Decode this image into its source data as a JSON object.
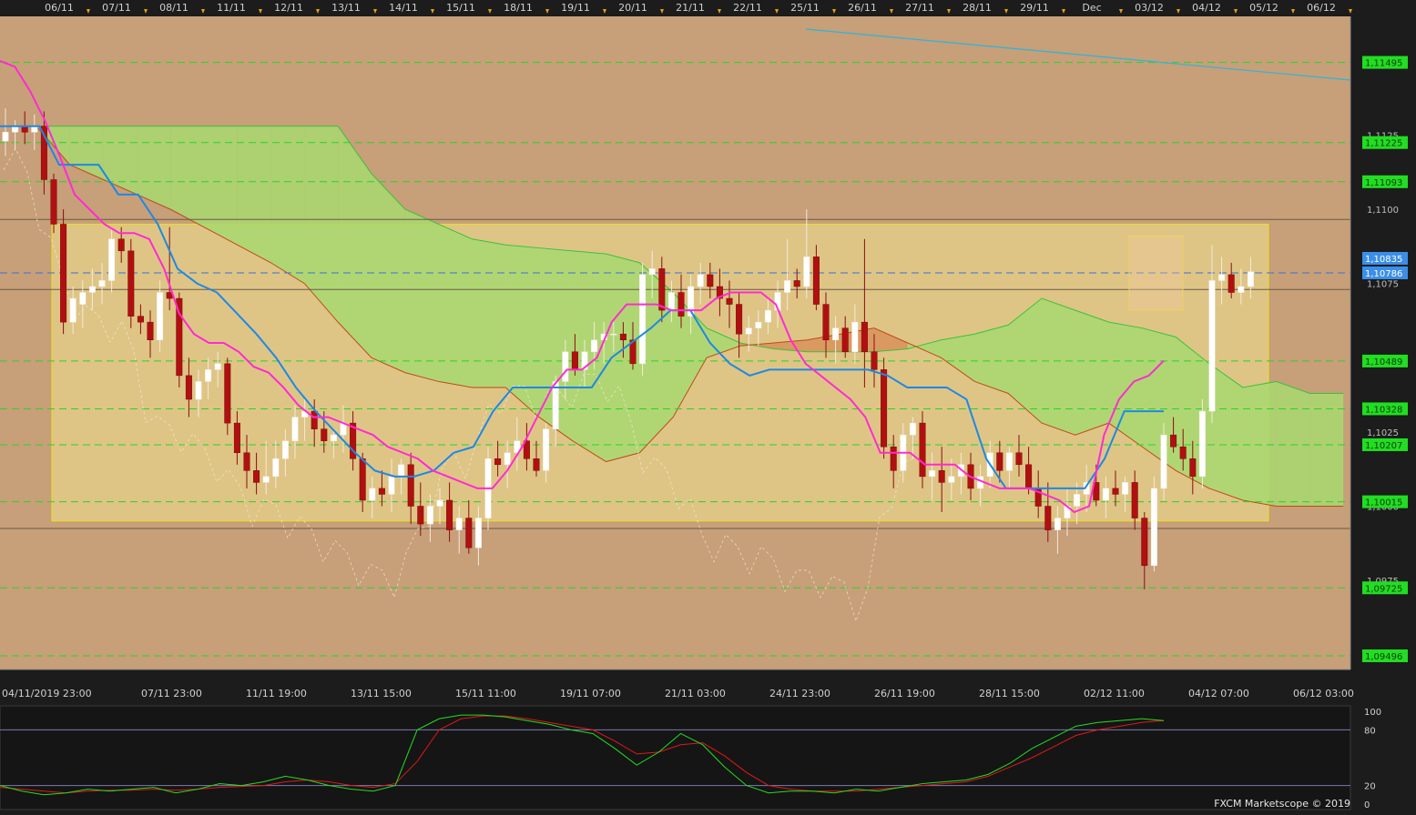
{
  "colors": {
    "background": "#1c1c1c",
    "plot_bg": "#c79f79",
    "highlight_box": "#e6d28a",
    "highlight_border": "#e8e020",
    "bull_candle": "#ffffff",
    "bear_candle": "#b01010",
    "tenkan": "#ff2bd2",
    "kijun": "#1e88e5",
    "chikou": "#f2ead8",
    "kumo_bull": "#a8d870",
    "kumo_bear": "#d9915a",
    "level_line": "#28d428",
    "price_marker_green": "#22dd22",
    "current_price_marker": "#3b8fe8",
    "trend_line": "#2ab6d8",
    "stoch_k": "#22dd22",
    "stoch_d": "#e01818"
  },
  "chart_data": {
    "type": "line",
    "title": "",
    "instrument_timeframe": "",
    "top_date_labels": [
      "06/11",
      "07/11",
      "08/11",
      "11/11",
      "12/11",
      "13/11",
      "14/11",
      "15/11",
      "18/11",
      "19/11",
      "20/11",
      "21/11",
      "22/11",
      "25/11",
      "26/11",
      "27/11",
      "28/11",
      "29/11",
      "Dec",
      "03/12",
      "04/12",
      "05/12",
      "06/12"
    ],
    "bottom_date_labels": [
      "04/11/2019 23:00",
      "07/11 23:00",
      "11/11 19:00",
      "13/11 15:00",
      "15/11 11:00",
      "19/11 07:00",
      "21/11 03:00",
      "24/11 23:00",
      "26/11 19:00",
      "28/11 15:00",
      "02/12 11:00",
      "04/12 07:00",
      "06/12 03:00"
    ],
    "y_axis": {
      "ylim": [
        1.0945,
        1.1165
      ],
      "tick_labels": [
        "1,1125",
        "1,1100",
        "1,1075",
        "1,1025",
        "1,1000",
        "1,0975"
      ],
      "tick_values": [
        1.1125,
        1.11,
        1.1075,
        1.1025,
        1.1,
        1.0975
      ]
    },
    "horizontal_levels": [
      {
        "label": "1,11495",
        "value": 1.11495,
        "style": "dashed"
      },
      {
        "label": "1,11225",
        "value": 1.11225,
        "style": "dashed"
      },
      {
        "label": "1,11093",
        "value": 1.11093,
        "style": "dashed"
      },
      {
        "label": "1,10489",
        "value": 1.10489,
        "style": "dashed"
      },
      {
        "label": "1,10328",
        "value": 1.10328,
        "style": "dashed"
      },
      {
        "label": "1,10207",
        "value": 1.10207,
        "style": "dashed"
      },
      {
        "label": "1,10015",
        "value": 1.10015,
        "style": "dashed"
      },
      {
        "label": "1,09725",
        "value": 1.09725,
        "style": "dashed"
      },
      {
        "label": "1,09496",
        "value": 1.09496,
        "style": "dashed"
      },
      {
        "label": "1,10835",
        "value": 1.10835,
        "style": "marker"
      }
    ],
    "current_price": {
      "label": "1,10786",
      "value": 1.10786
    },
    "highlight_range": {
      "from_index": 4,
      "to_index": 171,
      "high": 1.1095,
      "low": 0.0
    },
    "highlight_range_prices": {
      "high": 1.1095,
      "low": 1.0995
    },
    "range_lines": [
      1.10966,
      1.1073,
      1.09925
    ],
    "candles": [
      [
        1.1123,
        1.1134,
        1.1118,
        1.1126
      ],
      [
        1.1126,
        1.113,
        1.112,
        1.1128
      ],
      [
        1.1128,
        1.1133,
        1.1122,
        1.1126
      ],
      [
        1.1126,
        1.1132,
        1.112,
        1.1128
      ],
      [
        1.1128,
        1.1133,
        1.1105,
        1.111
      ],
      [
        1.111,
        1.1112,
        1.1092,
        1.1095
      ],
      [
        1.1095,
        1.11,
        1.1058,
        1.1062
      ],
      [
        1.1062,
        1.1074,
        1.1058,
        1.107
      ],
      [
        1.1068,
        1.1076,
        1.106,
        1.1072
      ],
      [
        1.1072,
        1.108,
        1.1066,
        1.1074
      ],
      [
        1.1074,
        1.1082,
        1.1068,
        1.1076
      ],
      [
        1.1076,
        1.1094,
        1.1072,
        1.109
      ],
      [
        1.109,
        1.1094,
        1.1082,
        1.1086
      ],
      [
        1.1086,
        1.109,
        1.106,
        1.1064
      ],
      [
        1.1064,
        1.1068,
        1.1058,
        1.1062
      ],
      [
        1.1062,
        1.1066,
        1.105,
        1.1056
      ],
      [
        1.1056,
        1.1076,
        1.1052,
        1.1072
      ],
      [
        1.1072,
        1.1094,
        1.1066,
        1.107
      ],
      [
        1.107,
        1.1072,
        1.104,
        1.1044
      ],
      [
        1.1044,
        1.105,
        1.103,
        1.1036
      ],
      [
        1.1036,
        1.1046,
        1.103,
        1.1042
      ],
      [
        1.1042,
        1.105,
        1.1036,
        1.1046
      ],
      [
        1.1046,
        1.1052,
        1.104,
        1.1048
      ],
      [
        1.1048,
        1.105,
        1.1024,
        1.1028
      ],
      [
        1.1028,
        1.1032,
        1.1014,
        1.1018
      ],
      [
        1.1018,
        1.1024,
        1.1006,
        1.1012
      ],
      [
        1.1012,
        1.1018,
        1.1004,
        1.1008
      ],
      [
        1.1008,
        1.1022,
        1.1004,
        1.101
      ],
      [
        1.101,
        1.1022,
        1.1006,
        1.1016
      ],
      [
        1.1016,
        1.1026,
        1.101,
        1.1022
      ],
      [
        1.1022,
        1.1034,
        1.1016,
        1.103
      ],
      [
        1.103,
        1.1036,
        1.1022,
        1.1032
      ],
      [
        1.1032,
        1.1036,
        1.102,
        1.1026
      ],
      [
        1.1026,
        1.1032,
        1.1018,
        1.1022
      ],
      [
        1.1022,
        1.1026,
        1.1016,
        1.1024
      ],
      [
        1.1024,
        1.1034,
        1.1018,
        1.1028
      ],
      [
        1.1028,
        1.1032,
        1.1012,
        1.1016
      ],
      [
        1.1016,
        1.1018,
        1.0998,
        1.1002
      ],
      [
        1.1002,
        1.101,
        1.0996,
        1.1006
      ],
      [
        1.1006,
        1.1012,
        1.1,
        1.1004
      ],
      [
        1.1004,
        1.1016,
        1.0998,
        1.101
      ],
      [
        1.101,
        1.1016,
        1.1004,
        1.1014
      ],
      [
        1.1014,
        1.1018,
        1.0994,
        1.1
      ],
      [
        1.1,
        1.1008,
        1.099,
        1.0994
      ],
      [
        1.0994,
        1.1004,
        1.0988,
        1.1
      ],
      [
        1.1,
        1.1006,
        1.0994,
        1.1002
      ],
      [
        1.1002,
        1.1008,
        1.0988,
        1.0992
      ],
      [
        1.0992,
        1.1,
        1.0984,
        1.0996
      ],
      [
        1.0996,
        1.1002,
        1.0984,
        1.0986
      ],
      [
        1.0986,
        1.1,
        1.098,
        1.0996
      ],
      [
        1.0996,
        1.102,
        1.0992,
        1.1016
      ],
      [
        1.1016,
        1.1022,
        1.101,
        1.1014
      ],
      [
        1.1014,
        1.1022,
        1.1006,
        1.1018
      ],
      [
        1.1018,
        1.103,
        1.1012,
        1.1022
      ],
      [
        1.1022,
        1.1028,
        1.1012,
        1.1016
      ],
      [
        1.1016,
        1.1022,
        1.101,
        1.1012
      ],
      [
        1.1012,
        1.1028,
        1.1008,
        1.1026
      ],
      [
        1.1026,
        1.1044,
        1.102,
        1.1042
      ],
      [
        1.1042,
        1.1056,
        1.1036,
        1.1052
      ],
      [
        1.1052,
        1.1058,
        1.1044,
        1.1046
      ],
      [
        1.1046,
        1.1056,
        1.104,
        1.1052
      ],
      [
        1.1052,
        1.1062,
        1.1046,
        1.1056
      ],
      [
        1.1056,
        1.1062,
        1.1048,
        1.1058
      ],
      [
        1.1058,
        1.1062,
        1.1052,
        1.1058
      ],
      [
        1.1058,
        1.1062,
        1.105,
        1.1056
      ],
      [
        1.1056,
        1.1062,
        1.1046,
        1.1048
      ],
      [
        1.1048,
        1.1082,
        1.1044,
        1.1078
      ],
      [
        1.1078,
        1.1086,
        1.107,
        1.108
      ],
      [
        1.108,
        1.1084,
        1.1062,
        1.1066
      ],
      [
        1.1066,
        1.1076,
        1.1062,
        1.1072
      ],
      [
        1.1072,
        1.1078,
        1.106,
        1.1064
      ],
      [
        1.1064,
        1.1078,
        1.1058,
        1.1074
      ],
      [
        1.1074,
        1.1082,
        1.1068,
        1.1078
      ],
      [
        1.1078,
        1.1082,
        1.107,
        1.1074
      ],
      [
        1.1074,
        1.108,
        1.1064,
        1.107
      ],
      [
        1.107,
        1.1076,
        1.106,
        1.1068
      ],
      [
        1.1068,
        1.1072,
        1.105,
        1.1058
      ],
      [
        1.1058,
        1.1064,
        1.1052,
        1.106
      ],
      [
        1.106,
        1.1066,
        1.1054,
        1.1062
      ],
      [
        1.1062,
        1.107,
        1.1058,
        1.1066
      ],
      [
        1.1066,
        1.1076,
        1.106,
        1.1072
      ],
      [
        1.1072,
        1.109,
        1.1066,
        1.1076
      ],
      [
        1.1076,
        1.108,
        1.107,
        1.1074
      ],
      [
        1.1074,
        1.11,
        1.107,
        1.1084
      ],
      [
        1.1084,
        1.1088,
        1.1066,
        1.1068
      ],
      [
        1.1068,
        1.1072,
        1.105,
        1.1056
      ],
      [
        1.1056,
        1.1064,
        1.1048,
        1.106
      ],
      [
        1.106,
        1.1064,
        1.105,
        1.1052
      ],
      [
        1.1052,
        1.1068,
        1.1048,
        1.1062
      ],
      [
        1.1062,
        1.109,
        1.104,
        1.1052
      ],
      [
        1.1052,
        1.1058,
        1.104,
        1.1046
      ],
      [
        1.1046,
        1.105,
        1.1016,
        1.102
      ],
      [
        1.102,
        1.1024,
        1.1006,
        1.1012
      ],
      [
        1.1012,
        1.1028,
        1.1008,
        1.1024
      ],
      [
        1.1024,
        1.103,
        1.1016,
        1.1028
      ],
      [
        1.1028,
        1.1032,
        1.1006,
        1.101
      ],
      [
        1.101,
        1.1018,
        1.1002,
        1.1012
      ],
      [
        1.1012,
        1.102,
        1.0998,
        1.1008
      ],
      [
        1.1008,
        1.1016,
        1.1002,
        1.101
      ],
      [
        1.101,
        1.1018,
        1.1004,
        1.1014
      ],
      [
        1.1014,
        1.1018,
        1.1002,
        1.1006
      ],
      [
        1.1006,
        1.1014,
        1.1,
        1.101
      ],
      [
        1.101,
        1.1022,
        1.1006,
        1.1018
      ],
      [
        1.1018,
        1.1022,
        1.1008,
        1.1012
      ],
      [
        1.1012,
        1.102,
        1.1006,
        1.1018
      ],
      [
        1.1018,
        1.1024,
        1.101,
        1.1014
      ],
      [
        1.1014,
        1.102,
        1.1004,
        1.1006
      ],
      [
        1.1006,
        1.1012,
        1.0996,
        1.1
      ],
      [
        1.1,
        1.1008,
        1.0988,
        1.0992
      ],
      [
        1.0992,
        1.1,
        1.0984,
        1.0996
      ],
      [
        1.0996,
        1.1006,
        1.099,
        1.1
      ],
      [
        1.1,
        1.1008,
        1.0994,
        1.1004
      ],
      [
        1.1004,
        1.1014,
        1.0998,
        1.1008
      ],
      [
        1.1008,
        1.1014,
        1.1,
        1.1002
      ],
      [
        1.1002,
        1.101,
        1.0996,
        1.1006
      ],
      [
        1.1006,
        1.1012,
        1.1,
        1.1004
      ],
      [
        1.1004,
        1.101,
        1.0998,
        1.1008
      ],
      [
        1.1008,
        1.1012,
        1.0992,
        1.0996
      ],
      [
        1.0996,
        1.0998,
        1.0972,
        1.098
      ],
      [
        1.098,
        1.101,
        1.0978,
        1.1006
      ],
      [
        1.1006,
        1.1028,
        1.1002,
        1.1024
      ],
      [
        1.1024,
        1.103,
        1.1018,
        1.102
      ],
      [
        1.102,
        1.1026,
        1.1012,
        1.1016
      ],
      [
        1.1016,
        1.1022,
        1.1004,
        1.101
      ],
      [
        1.101,
        1.1036,
        1.1006,
        1.1032
      ],
      [
        1.1032,
        1.1088,
        1.1028,
        1.1076
      ],
      [
        1.1076,
        1.1084,
        1.1068,
        1.1078
      ],
      [
        1.1078,
        1.1082,
        1.107,
        1.1072
      ],
      [
        1.1072,
        1.108,
        1.1068,
        1.1074
      ],
      [
        1.1074,
        1.1084,
        1.107,
        1.1079
      ]
    ],
    "tenkan_sen": [
      1.115,
      1.1148,
      1.114,
      1.113,
      1.1118,
      1.1105,
      1.11,
      1.1095,
      1.1092,
      1.1092,
      1.109,
      1.108,
      1.1065,
      1.1058,
      1.1055,
      1.1055,
      1.1052,
      1.1047,
      1.1045,
      1.104,
      1.1034,
      1.103,
      1.103,
      1.1028,
      1.1026,
      1.1024,
      1.102,
      1.1018,
      1.1016,
      1.1012,
      1.101,
      1.1008,
      1.1006,
      1.1006,
      1.1012,
      1.102,
      1.103,
      1.104,
      1.1046,
      1.1046,
      1.105,
      1.1062,
      1.1068,
      1.1068,
      1.1068,
      1.1066,
      1.1066,
      1.1066,
      1.107,
      1.1072,
      1.1072,
      1.1072,
      1.1068,
      1.1056,
      1.1048,
      1.1044,
      1.104,
      1.1036,
      1.103,
      1.1018,
      1.1018,
      1.1018,
      1.1014,
      1.1014,
      1.1014,
      1.101,
      1.1008,
      1.1006,
      1.1006,
      1.1006,
      1.1004,
      1.1002,
      1.0998,
      1.1,
      1.1024,
      1.1036,
      1.1042,
      1.1044,
      1.1049
    ],
    "kijun_sen": [
      1.1128,
      1.1128,
      1.1128,
      1.1115,
      1.1115,
      1.1115,
      1.1105,
      1.1105,
      1.1095,
      1.108,
      1.1075,
      1.1072,
      1.1065,
      1.1058,
      1.105,
      1.104,
      1.1032,
      1.1025,
      1.1018,
      1.1012,
      1.101,
      1.101,
      1.1012,
      1.1018,
      1.102,
      1.1032,
      1.104,
      1.104,
      1.104,
      1.104,
      1.104,
      1.105,
      1.1055,
      1.106,
      1.1066,
      1.1066,
      1.1055,
      1.1048,
      1.1044,
      1.1046,
      1.1046,
      1.1046,
      1.1046,
      1.1046,
      1.1046,
      1.1044,
      1.104,
      1.104,
      1.104,
      1.1036,
      1.1016,
      1.1006,
      1.1006,
      1.1006,
      1.1006,
      1.1006,
      1.1016,
      1.1032,
      1.1032,
      1.1032
    ],
    "kumo_senkou_a": [
      1.1128,
      1.1128,
      1.1128,
      1.1128,
      1.1128,
      1.1128,
      1.1128,
      1.1128,
      1.1128,
      1.1128,
      1.1112,
      1.11,
      1.1095,
      1.109,
      1.1088,
      1.1087,
      1.1086,
      1.1085,
      1.1082,
      1.1072,
      1.106,
      1.1055,
      1.1053,
      1.1052,
      1.1052,
      1.1052,
      1.1053,
      1.1056,
      1.1058,
      1.1061,
      1.107,
      1.1066,
      1.1062,
      1.106,
      1.1057,
      1.1048,
      1.104,
      1.1042,
      1.1038,
      1.1038
    ],
    "kumo_senkou_b": [
      1.1128,
      1.1115,
      1.111,
      1.1105,
      1.11,
      1.1094,
      1.1088,
      1.1082,
      1.1075,
      1.1062,
      1.105,
      1.1045,
      1.1042,
      1.104,
      1.104,
      1.103,
      1.1022,
      1.1015,
      1.1018,
      1.103,
      1.105,
      1.1054,
      1.1055,
      1.1056,
      1.1058,
      1.106,
      1.1055,
      1.105,
      1.1042,
      1.1038,
      1.1028,
      1.1024,
      1.1028,
      1.102,
      1.1012,
      1.1006,
      1.1002,
      1.1,
      1.1,
      1.1
    ],
    "stochastic": {
      "levels": [
        "100",
        "80",
        "20",
        "0"
      ],
      "level_values": [
        100,
        80,
        20,
        0
      ],
      "k": [
        20,
        14,
        10,
        12,
        16,
        14,
        16,
        18,
        12,
        16,
        22,
        20,
        24,
        30,
        26,
        20,
        16,
        14,
        20,
        80,
        92,
        96,
        96,
        94,
        90,
        86,
        80,
        76,
        60,
        42,
        56,
        76,
        64,
        40,
        20,
        12,
        14,
        14,
        12,
        16,
        14,
        18,
        22,
        24,
        26,
        32,
        44,
        60,
        72,
        84,
        88,
        90,
        92,
        90
      ],
      "d": [
        18,
        16,
        14,
        12,
        14,
        15,
        15,
        16,
        15,
        16,
        18,
        19,
        20,
        24,
        26,
        24,
        20,
        18,
        22,
        46,
        80,
        92,
        95,
        95,
        92,
        88,
        84,
        80,
        68,
        54,
        56,
        64,
        66,
        52,
        34,
        20,
        16,
        14,
        14,
        14,
        16,
        18,
        20,
        22,
        24,
        30,
        40,
        50,
        62,
        74,
        80,
        84,
        88,
        90
      ]
    }
  },
  "watermark": "FXCM Marketscope © 2019"
}
